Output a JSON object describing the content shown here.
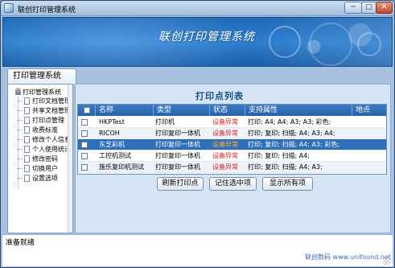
{
  "window": {
    "title": "联创打印管理系统",
    "buttons": {
      "minimize": "─",
      "maximize": "□",
      "close": "✕"
    }
  },
  "banner": {
    "title": "联创打印管理系统"
  },
  "sidebar": {
    "tab": "打印管理系统",
    "root": "打印管理系统",
    "items": [
      {
        "label": "打印文档管理"
      },
      {
        "label": "共享文档管理"
      },
      {
        "label": "打印点管理"
      },
      {
        "label": "收费标准"
      },
      {
        "label": "修改个人信息"
      },
      {
        "label": "个人使用统计"
      },
      {
        "label": "修改密码"
      },
      {
        "label": "切换用户"
      },
      {
        "label": "设置选项"
      }
    ]
  },
  "printer_list": {
    "title": "打印点列表",
    "columns": [
      "名称",
      "类型",
      "状态",
      "支持属性",
      "地点"
    ],
    "rows": [
      {
        "name": "HKPTest",
        "type": "打印机",
        "status": "设备异常",
        "features": "打印; A4; A4; A3; A3; 彩色;",
        "location": ""
      },
      {
        "name": "RICOH",
        "type": "打印复印一体机",
        "status": "设备异常",
        "features": "打印; 复印; 扫描; A4; A3; A4;",
        "location": ""
      },
      {
        "name": "东芝彩机",
        "type": "打印复印一体机",
        "status": "设备异常",
        "features": "打印; 复印; 扫描; A4; A3; 彩色;",
        "location": ""
      },
      {
        "name": "工控机测试",
        "type": "打印复印一体机",
        "status": "设备异常",
        "features": "打印; 复印; 扫描; A4;",
        "location": ""
      },
      {
        "name": "施乐复印机测试",
        "type": "打印复印一体机",
        "status": "设备异常",
        "features": "打印; 复印; 扫描; A4; A3;",
        "location": ""
      }
    ],
    "selected_row": 2,
    "buttons": {
      "refresh": "刷新打印点",
      "remember": "记住选中项",
      "show_all": "显示所有项"
    }
  },
  "statusbar": {
    "text": "准备就绪",
    "watermark": "联创数码 www.unifound.net"
  },
  "colors": {
    "header_bg": "#2461a8",
    "status_text": "#e01b1b",
    "selected_row": "#2e6fb8"
  }
}
